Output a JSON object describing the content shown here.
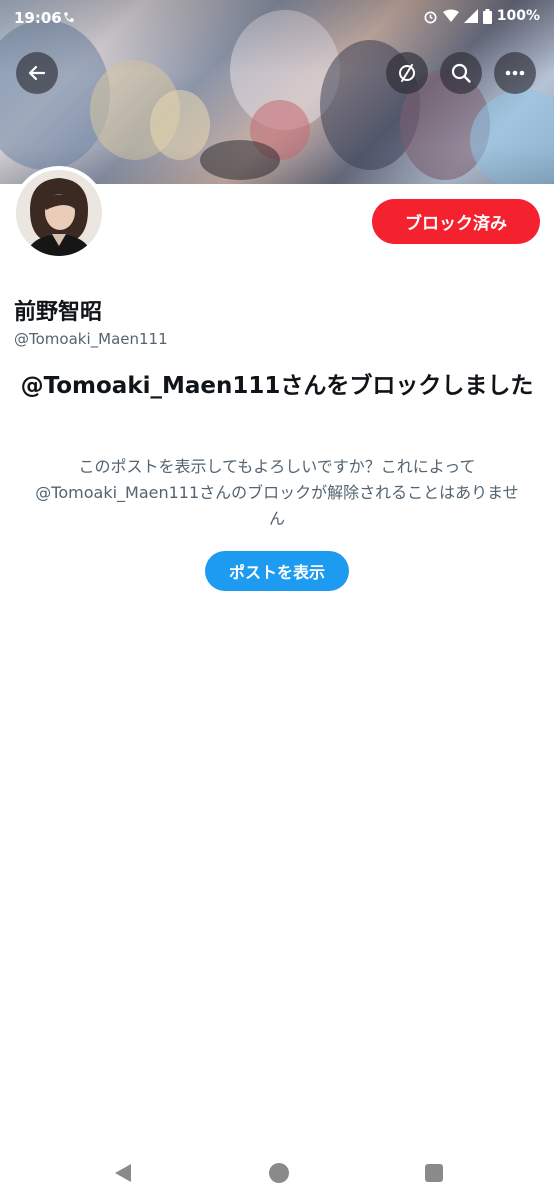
{
  "status_bar": {
    "time": "19:06",
    "battery": "100%"
  },
  "header": {
    "icons": [
      "back-arrow-icon",
      "translate-icon",
      "search-icon",
      "more-icon"
    ]
  },
  "profile": {
    "blocked_label": "ブロック済み",
    "display_name": "前野智昭",
    "handle": "@Tomoaki_Maen111"
  },
  "blocked_notice": {
    "heading": "@Tomoaki_Maen111さんをブロックしました",
    "message": "このポストを表示してもよろしいですか？これによって@Tomoaki_Maen111さんのブロックが解除されることはありません",
    "view_posts_label": "ポストを表示"
  },
  "colors": {
    "blocked_red": "#f4212e",
    "twitter_blue": "#1d9bf0",
    "secondary_text": "#536471"
  }
}
